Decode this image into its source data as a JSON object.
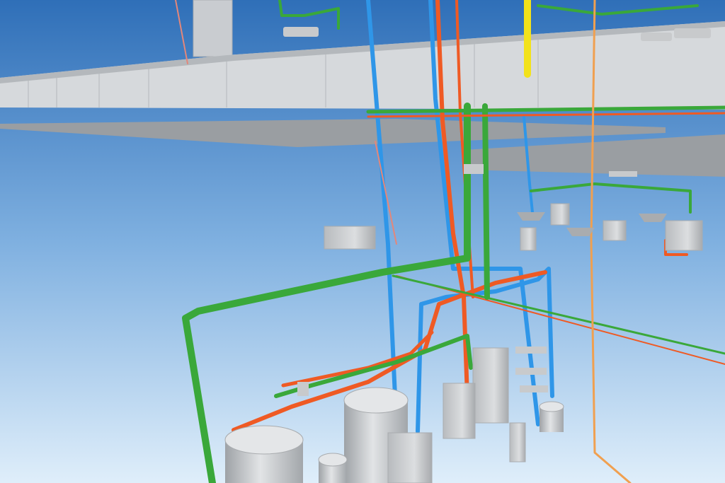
{
  "scene": {
    "colors": {
      "sky_top": "#2f6fb8",
      "sky_mid": "#7fb0e0",
      "sky_bottom": "#dfeefa",
      "slab": "#d6d9dc",
      "slab_edge": "#b4b8bc",
      "slab_shadow": "#9a9ea2",
      "equipment": "#c8cacc",
      "equipment_dark": "#a9acaf",
      "pipe_green": "#3aa83a",
      "pipe_red": "#ef5a24",
      "pipe_blue": "#2f96e8",
      "pipe_orange": "#f0a050",
      "pipe_yellow": "#f2e21a",
      "pipe_pink": "#e4877a"
    },
    "icons": [
      "tank",
      "pump",
      "fixture",
      "cabinet"
    ]
  }
}
